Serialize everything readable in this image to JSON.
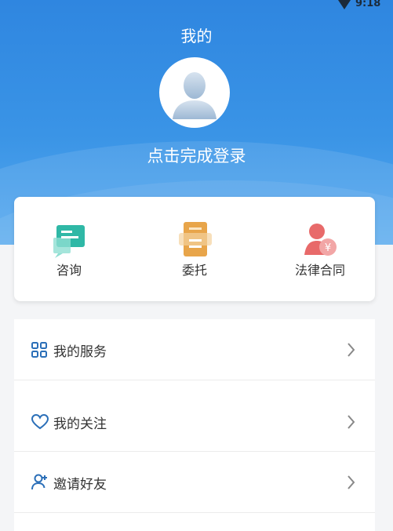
{
  "status": {
    "time": "9:18"
  },
  "header": {
    "title": "我的",
    "login_prompt": "点击完成登录"
  },
  "quick_actions": [
    {
      "label": "咨询",
      "icon": "consult-icon",
      "color": "#2fb8a6"
    },
    {
      "label": "委托",
      "icon": "entrust-icon",
      "color": "#e8a54a"
    },
    {
      "label": "法律合同",
      "icon": "contract-icon",
      "color": "#e86a6a"
    }
  ],
  "menu": [
    {
      "label": "我的服务",
      "icon": "grid-icon"
    },
    {
      "label": "我的关注",
      "icon": "heart-icon"
    },
    {
      "label": "邀请好友",
      "icon": "add-user-icon"
    }
  ],
  "colors": {
    "accent": "#2f86e0",
    "icon_blue": "#2b6fb8"
  }
}
